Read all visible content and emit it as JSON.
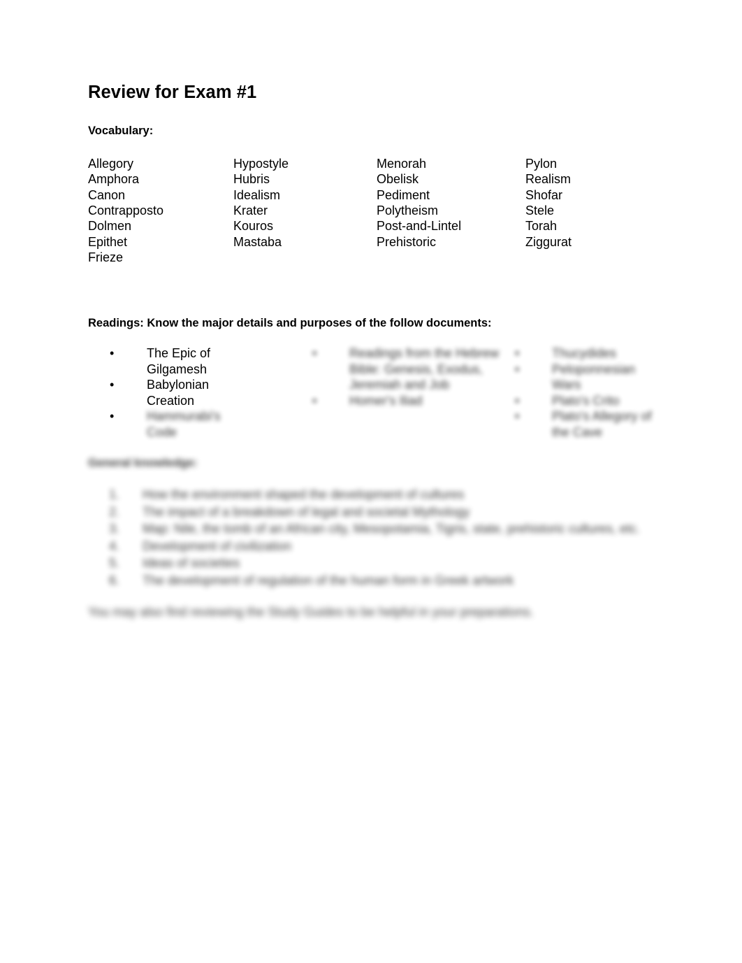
{
  "document": {
    "title": "Review for Exam #1",
    "vocabulary": {
      "label": "Vocabulary:",
      "columns": [
        [
          "Allegory",
          "Amphora",
          "Canon",
          "Contrapposto",
          "Dolmen",
          "Epithet",
          "Frieze"
        ],
        [
          "Hypostyle",
          "Hubris",
          "Idealism",
          "Krater",
          "Kouros",
          "Mastaba"
        ],
        [
          "Menorah",
          "Obelisk",
          "Pediment",
          "Polytheism",
          "Post-and-Lintel",
          "Prehistoric"
        ],
        [
          "Pylon",
          "Realism",
          "Shofar",
          "Stele",
          "Torah",
          "Ziggurat"
        ]
      ]
    },
    "readings": {
      "heading": "Readings:  Know the major details and purposes of the follow documents:",
      "column_1": [
        {
          "marker": "•",
          "text": "The Epic of Gilgamesh",
          "blur": "none"
        },
        {
          "marker": "•",
          "text": "Babylonian Creation",
          "blur": "none"
        },
        {
          "marker": "•",
          "text": "Hammurabi's Code",
          "blur": "b2"
        }
      ],
      "column_2": [
        {
          "marker": "•",
          "text": "Readings from the Hebrew Bible: Genesis, Exodus, Jeremiah and Job",
          "blur": "b2"
        },
        {
          "marker": "•",
          "text": "Homer's Iliad",
          "blur": "b2"
        }
      ],
      "column_3": [
        {
          "marker": "•",
          "text": "Thucydides",
          "blur": "b2"
        },
        {
          "marker": "•",
          "text": "Peloponnesian Wars",
          "blur": "b2"
        },
        {
          "marker": "•",
          "text": "Plato's Crito",
          "blur": "b2"
        },
        {
          "marker": "•",
          "text": "Plato's Allegory of the Cave",
          "blur": "b2"
        }
      ]
    },
    "general": {
      "heading": "General knowledge:",
      "items": [
        {
          "marker": "1.",
          "text": "How the environment shaped the development of cultures"
        },
        {
          "marker": "2.",
          "text": "The impact of a breakdown of legal and societal Mythology"
        },
        {
          "marker": "3.",
          "text": "Map: Nile, the tomb of an African city, Mesopotamia, Tigris, state, prehistoric cultures, etc."
        },
        {
          "marker": "4.",
          "text": "Development of civilization"
        },
        {
          "marker": "5.",
          "text": "Ideas of societies"
        },
        {
          "marker": "6.",
          "text": "The development of regulation of the human form in Greek artwork"
        }
      ],
      "closing": "You may also find reviewing the Study Guides to be helpful in your preparations."
    }
  }
}
